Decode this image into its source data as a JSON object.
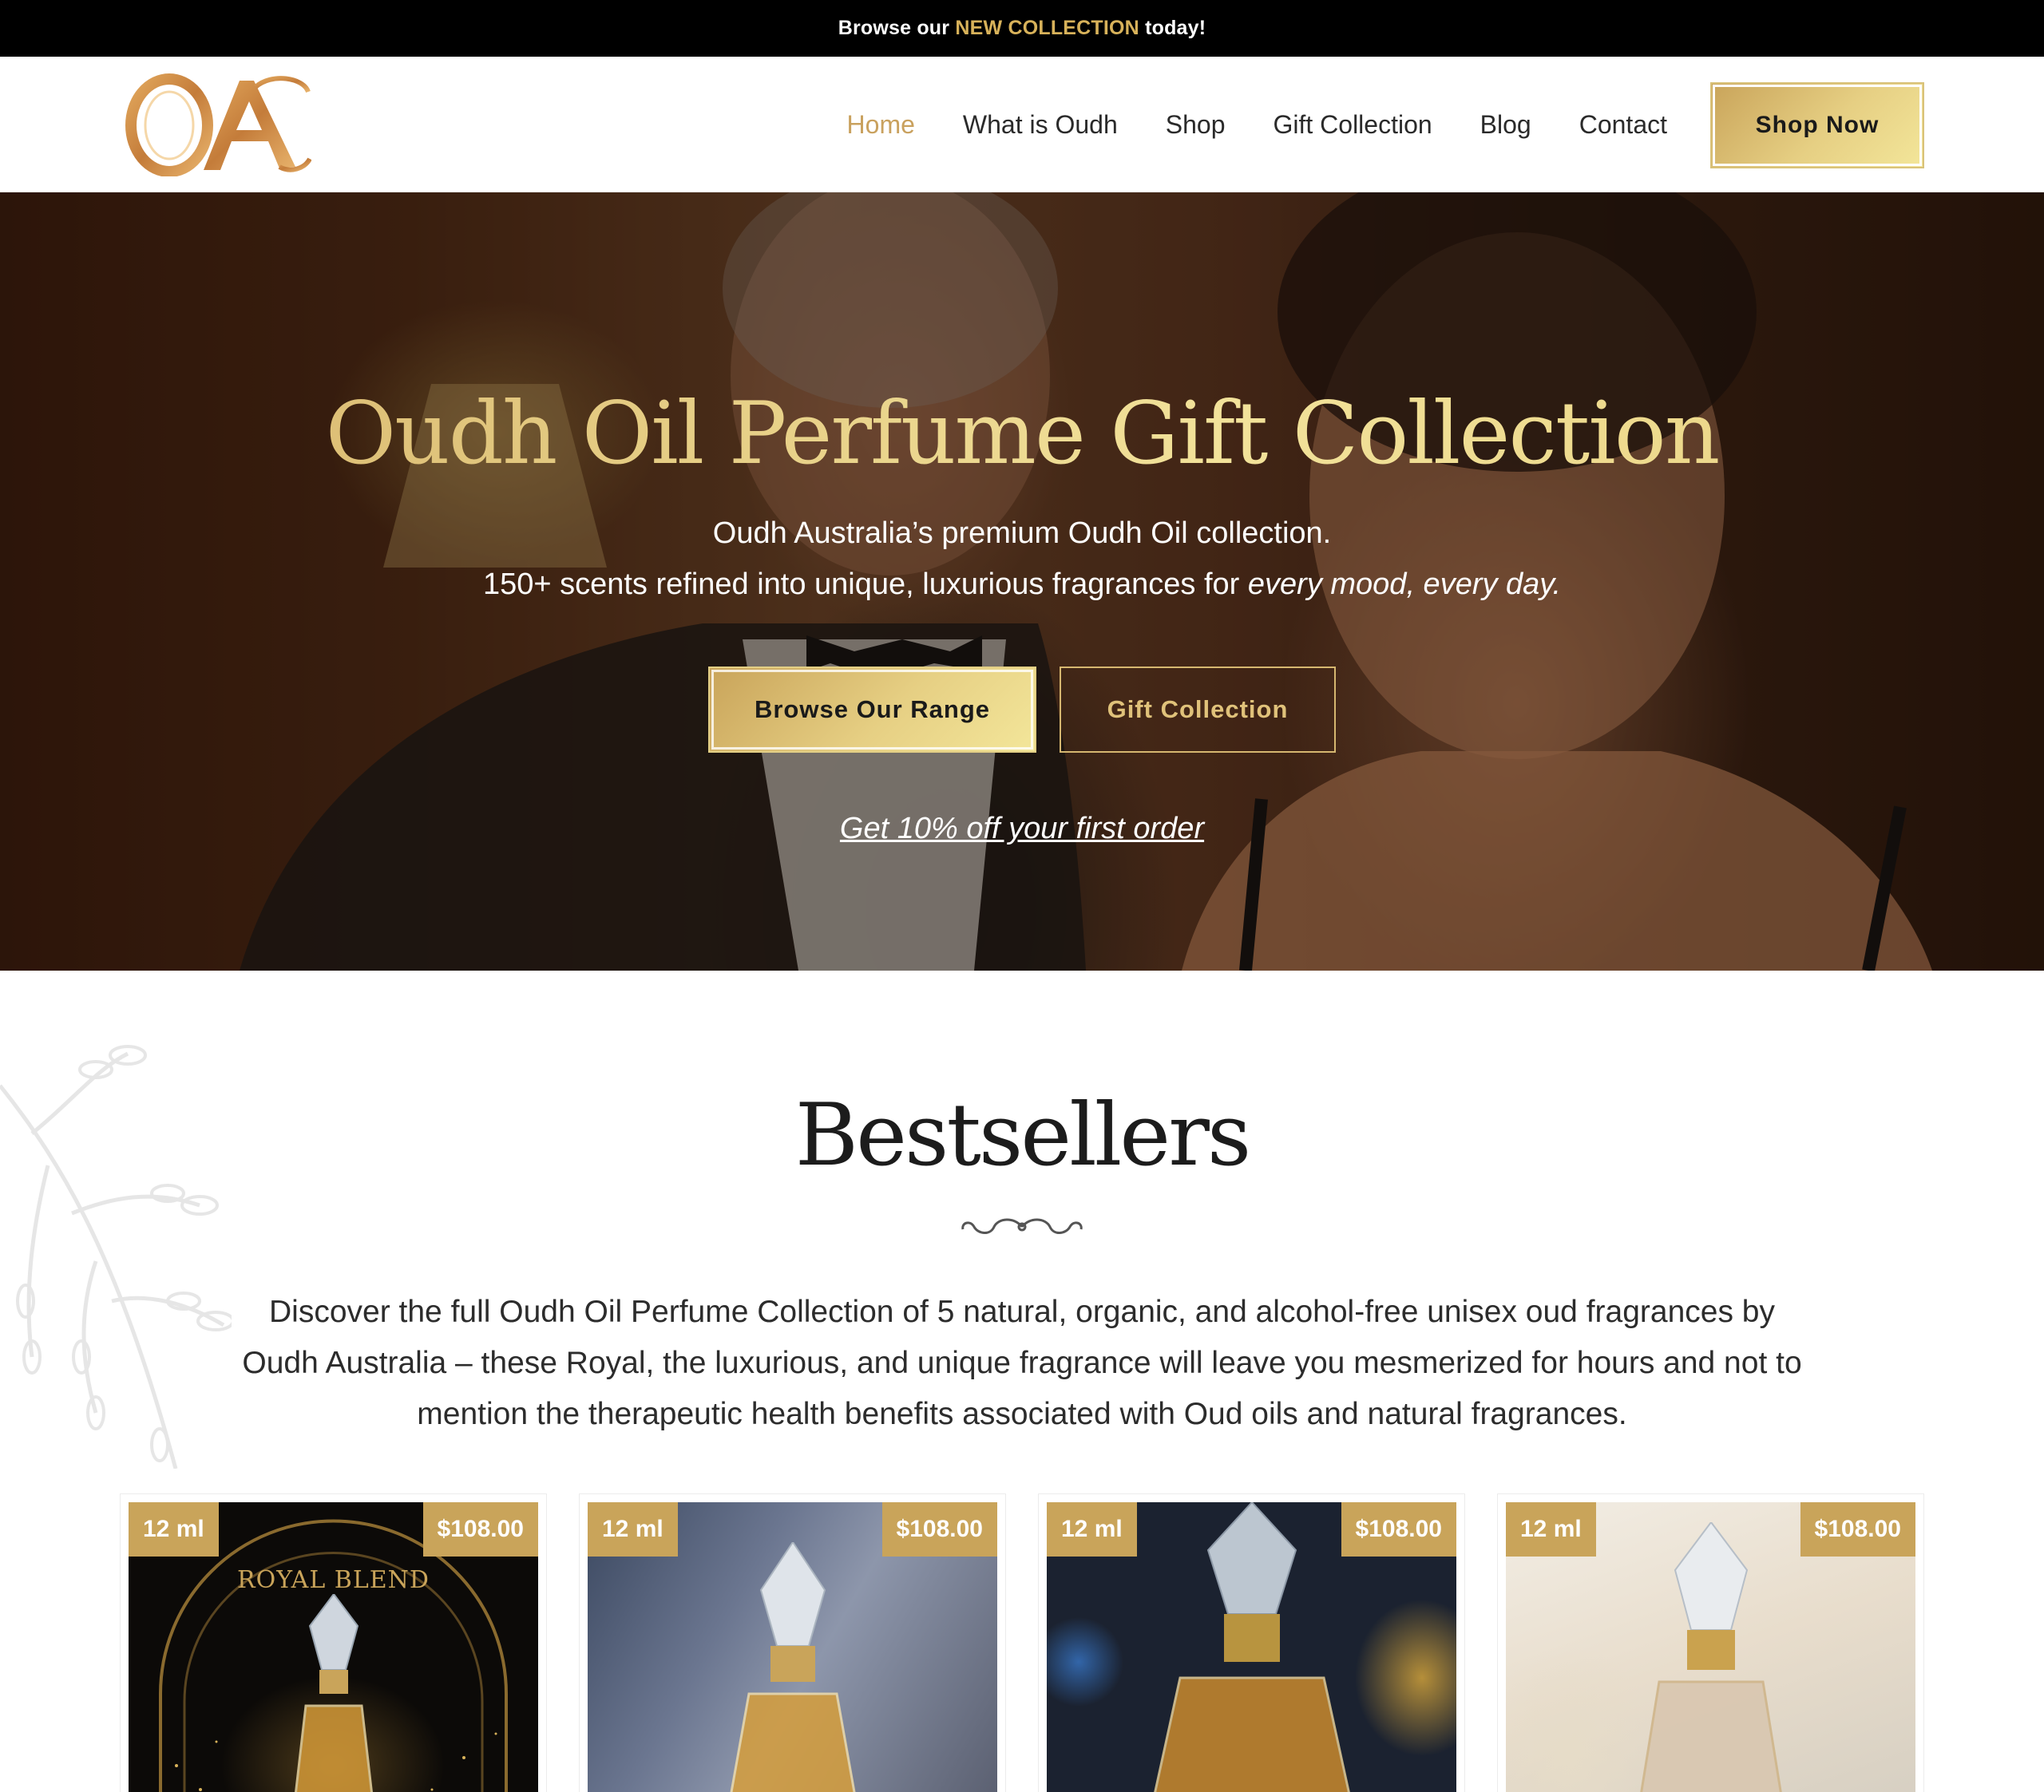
{
  "announcement": {
    "prefix": "Browse our",
    "highlight": "NEW COLLECTION",
    "suffix": "today!"
  },
  "header": {
    "logo_text": "OA",
    "nav": [
      {
        "label": "Home",
        "active": true
      },
      {
        "label": "What is Oudh",
        "active": false
      },
      {
        "label": "Shop",
        "active": false
      },
      {
        "label": "Gift Collection",
        "active": false
      },
      {
        "label": "Blog",
        "active": false
      },
      {
        "label": "Contact",
        "active": false
      }
    ],
    "cta_label": "Shop Now"
  },
  "hero": {
    "title": "Oudh Oil Perfume Gift Collection",
    "subtitle_line1": "Oudh Australia’s premium Oudh Oil collection.",
    "subtitle_line2_prefix": "150+ scents refined into unique, luxurious fragrances for",
    "subtitle_line2_emphasis": "every mood, every day.",
    "primary_button": "Browse Our Range",
    "secondary_button": "Gift Collection",
    "offer_link": "Get 10% off your first order"
  },
  "bestsellers": {
    "title": "Bestsellers",
    "description": "Discover the full Oudh Oil Perfume Collection of 5 natural, organic, and alcohol-free unisex oud fragrances by Oudh Australia – these Royal, the luxurious, and unique fragrance will leave you mesmerized for hours and not to mention the therapeutic health benefits associated with Oud oils and natural fragrances.",
    "products": [
      {
        "size": "12 ml",
        "price": "$108.00",
        "image_label": "ROYAL BLEND"
      },
      {
        "size": "12 ml",
        "price": "$108.00",
        "image_label": ""
      },
      {
        "size": "12 ml",
        "price": "$108.00",
        "image_label": ""
      },
      {
        "size": "12 ml",
        "price": "$108.00",
        "image_label": ""
      }
    ]
  },
  "colors": {
    "gold": "#c9a45a",
    "gold_light": "#f3e69a",
    "nav_active": "#c9a15e",
    "topbar_bg": "#000000"
  }
}
